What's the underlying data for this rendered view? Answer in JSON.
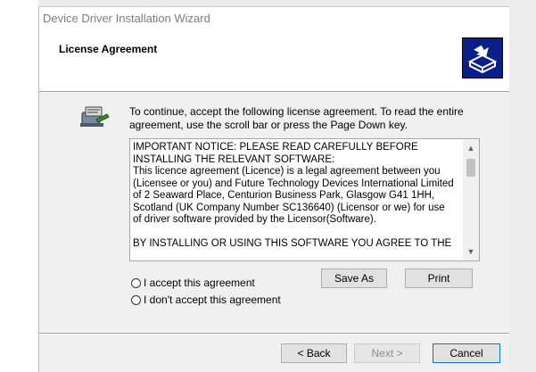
{
  "window": {
    "title": "Device Driver Installation Wizard"
  },
  "header": {
    "title": "License Agreement",
    "logo_icon": "driver-install-icon"
  },
  "intro": {
    "icon": "wizard-icon",
    "text": "To continue, accept the following license agreement. To read the entire agreement, use the scroll bar or press the Page Down key."
  },
  "license": {
    "text": "IMPORTANT NOTICE: PLEASE READ CAREFULLY BEFORE\nINSTALLING THE RELEVANT SOFTWARE:\nThis licence agreement (Licence) is a legal agreement between you (Licensee or you) and Future Technology Devices International Limited of 2 Seaward Place, Centurion Business Park, Glasgow G41 1HH, Scotland (UK Company Number SC136640) (Licensor or we) for use of driver software provided by the Licensor(Software).\n\nBY INSTALLING OR USING THIS SOFTWARE YOU AGREE TO THE"
  },
  "options": {
    "accept_label": "I accept this agreement",
    "decline_label": "I don't accept this agreement",
    "selected": "none"
  },
  "buttons": {
    "save_as": "Save As",
    "print": "Print",
    "back": "< Back",
    "next": "Next >",
    "cancel": "Cancel"
  },
  "colors": {
    "logo_background": "#0a1f8a",
    "focus_border": "#0078d7"
  }
}
